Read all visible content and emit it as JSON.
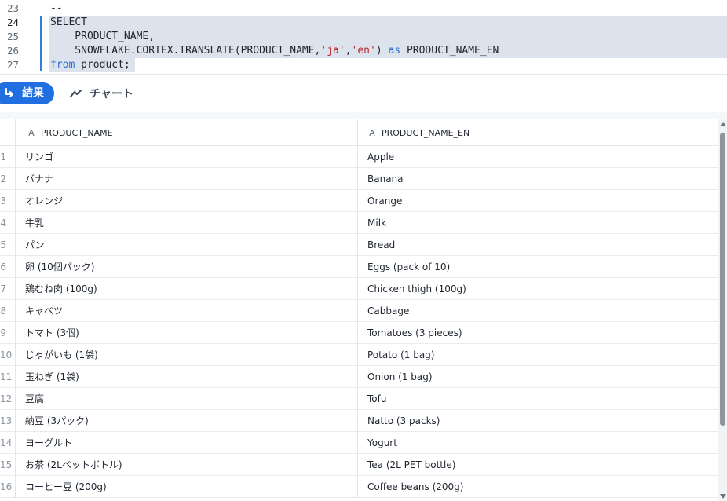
{
  "editor": {
    "lines": [
      {
        "num": "23",
        "text": "--"
      },
      {
        "num": "24",
        "text": "SELECT"
      },
      {
        "num": "25",
        "text": "    PRODUCT_NAME,"
      },
      {
        "num": "26",
        "text_parts": [
          "    SNOWFLAKE.CORTEX.TRANSLATE(PRODUCT_NAME,",
          "'ja'",
          ",",
          "'en'",
          ") ",
          "as",
          " PRODUCT_NAME_EN"
        ]
      },
      {
        "num": "27",
        "text_parts": [
          "from",
          " product;"
        ]
      }
    ]
  },
  "tabs": {
    "results_label": "結果",
    "chart_label": "チャート"
  },
  "grid": {
    "columns": [
      {
        "type_icon": "A",
        "name": "PRODUCT_NAME"
      },
      {
        "type_icon": "A",
        "name": "PRODUCT_NAME_EN"
      }
    ],
    "rows": [
      {
        "num": "1",
        "name": "リンゴ",
        "name_en": "Apple"
      },
      {
        "num": "2",
        "name": "バナナ",
        "name_en": "Banana"
      },
      {
        "num": "3",
        "name": "オレンジ",
        "name_en": "Orange"
      },
      {
        "num": "4",
        "name": "牛乳",
        "name_en": "Milk"
      },
      {
        "num": "5",
        "name": "パン",
        "name_en": "Bread"
      },
      {
        "num": "6",
        "name": "卵 (10個パック)",
        "name_en": "Eggs (pack of 10)"
      },
      {
        "num": "7",
        "name": "鶏むね肉 (100g)",
        "name_en": "Chicken thigh (100g)"
      },
      {
        "num": "8",
        "name": "キャベツ",
        "name_en": "Cabbage"
      },
      {
        "num": "9",
        "name": "トマト (3個)",
        "name_en": "Tomatoes (3 pieces)"
      },
      {
        "num": "10",
        "name": "じゃがいも (1袋)",
        "name_en": "Potato (1 bag)"
      },
      {
        "num": "11",
        "name": "玉ねぎ (1袋)",
        "name_en": "Onion (1 bag)"
      },
      {
        "num": "12",
        "name": "豆腐",
        "name_en": "Tofu"
      },
      {
        "num": "13",
        "name": "納豆 (3パック)",
        "name_en": "Natto (3 packs)"
      },
      {
        "num": "14",
        "name": "ヨーグルト",
        "name_en": "Yogurt"
      },
      {
        "num": "15",
        "name": "お茶 (2Lペットボトル)",
        "name_en": "Tea (2L PET bottle)"
      },
      {
        "num": "16",
        "name": "コーヒー豆 (200g)",
        "name_en": "Coffee beans (200g)"
      }
    ]
  },
  "colors": {
    "accent": "#1f6fe0",
    "keyword": "#2a6fdb",
    "string": "#b8282c",
    "selection": "#dde3ec"
  }
}
